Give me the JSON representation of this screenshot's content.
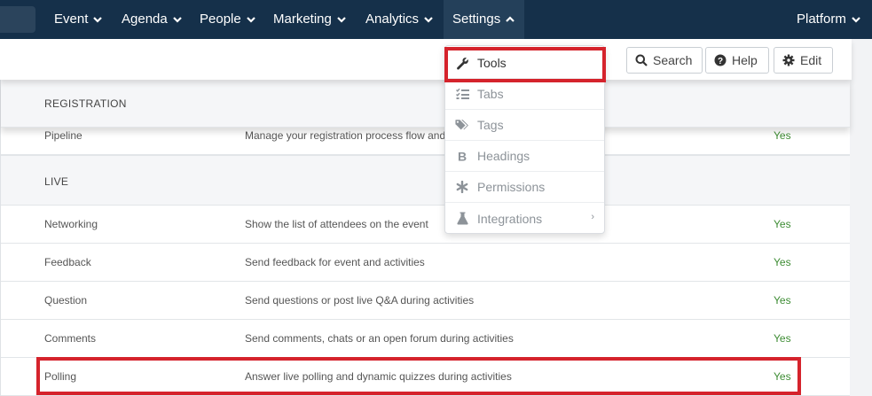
{
  "nav": {
    "items": [
      {
        "label": "Event"
      },
      {
        "label": "Agenda"
      },
      {
        "label": "People"
      },
      {
        "label": "Marketing"
      },
      {
        "label": "Analytics"
      },
      {
        "label": "Settings"
      }
    ],
    "platform_label": "Platform"
  },
  "toolbar": {
    "search_label": "Search",
    "help_label": "Help",
    "edit_label": "Edit"
  },
  "dropdown": {
    "items": [
      {
        "label": "Tools",
        "icon": "wrench-icon"
      },
      {
        "label": "Tabs",
        "icon": "list-check-icon"
      },
      {
        "label": "Tags",
        "icon": "tags-icon"
      },
      {
        "label": "Headings",
        "icon": "bold-icon"
      },
      {
        "label": "Permissions",
        "icon": "asterisk-icon"
      },
      {
        "label": "Integrations",
        "icon": "flask-icon"
      }
    ],
    "submenu_arrow": "›"
  },
  "sections": {
    "registration": {
      "title": "REGISTRATION",
      "rows": [
        {
          "name": "Pipeline",
          "description": "Manage your registration process flow and",
          "enabled": "Yes"
        }
      ]
    },
    "live": {
      "title": "LIVE",
      "rows": [
        {
          "name": "Networking",
          "description": "Show the list of attendees on the event",
          "enabled": "Yes"
        },
        {
          "name": "Feedback",
          "description": "Send feedback for event and activities",
          "enabled": "Yes"
        },
        {
          "name": "Question",
          "description": "Send questions or post live Q&A during activities",
          "enabled": "Yes"
        },
        {
          "name": "Comments",
          "description": "Send comments, chats or an open forum during activities",
          "enabled": "Yes"
        },
        {
          "name": "Polling",
          "description": "Answer live polling and dynamic quizzes during activities",
          "enabled": "Yes"
        }
      ]
    }
  },
  "colors": {
    "nav_bg": "#15304a",
    "highlight": "#d5232c",
    "yes": "#3d8c33"
  }
}
